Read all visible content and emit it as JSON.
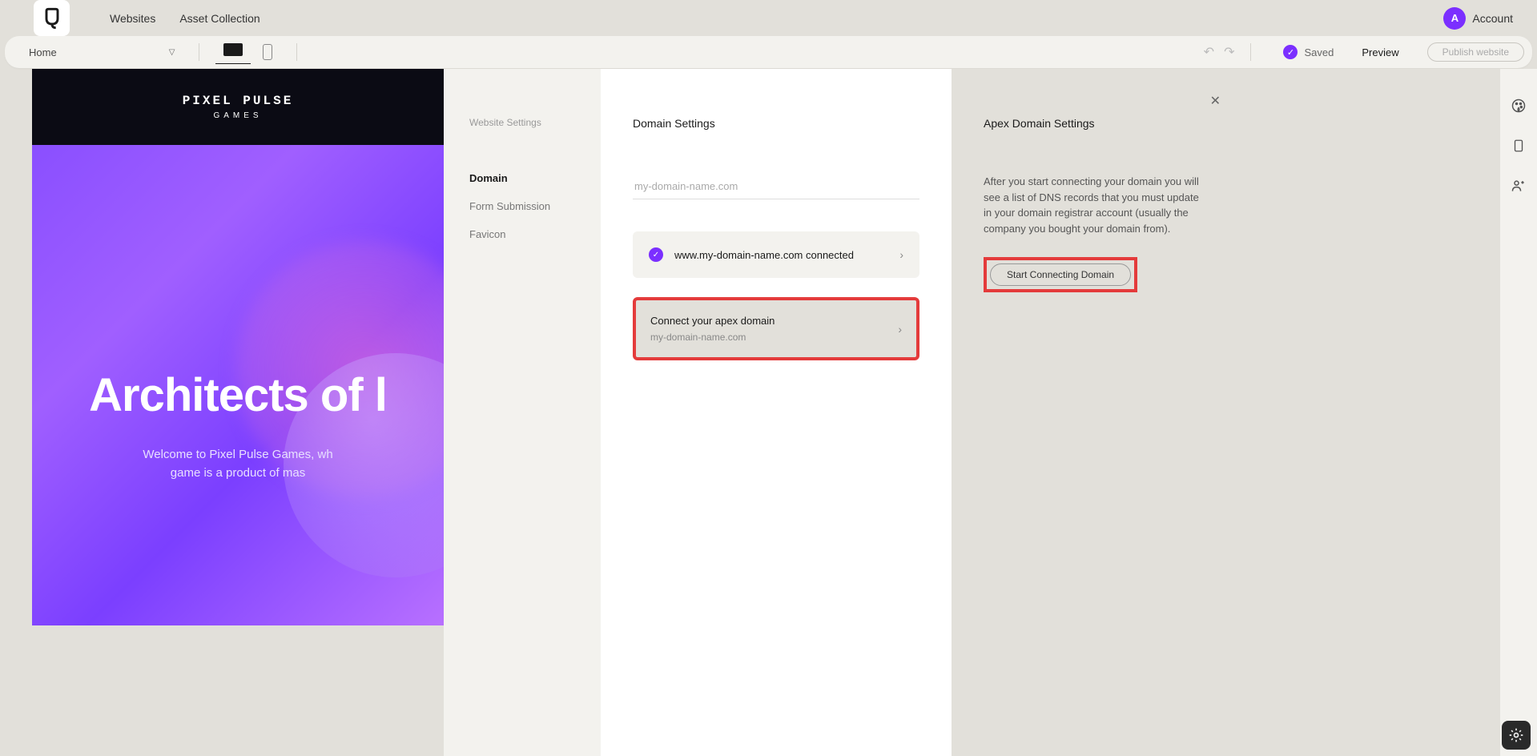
{
  "topnav": {
    "links": {
      "websites": "Websites",
      "assets": "Asset Collection"
    },
    "account": {
      "label": "Account",
      "initial": "A"
    }
  },
  "subbar": {
    "page_selector": "Home",
    "saved_label": "Saved",
    "preview_label": "Preview",
    "publish_label": "Publish website"
  },
  "site_preview": {
    "logo_main": "PIXEL PULSE",
    "logo_sub": "GAMES",
    "hero_title": "Architects of l",
    "hero_sub_line1": "Welcome to Pixel Pulse Games, wh",
    "hero_sub_line2": "game is a product of mas"
  },
  "settings_nav": {
    "title": "Website Settings",
    "items": {
      "domain": "Domain",
      "form": "Form Submission",
      "favicon": "Favicon"
    }
  },
  "domain_panel": {
    "title": "Domain Settings",
    "input_placeholder": "my-domain-name.com",
    "connected_card": "www.my-domain-name.com connected",
    "apex_card_title": "Connect your apex domain",
    "apex_card_sub": "my-domain-name.com"
  },
  "apex_panel": {
    "title": "Apex Domain Settings",
    "description": "After you start connecting your domain you will see a list of DNS records that you must update in your domain registrar account (usually the company you bought your domain from).",
    "button": "Start Connecting Domain"
  }
}
